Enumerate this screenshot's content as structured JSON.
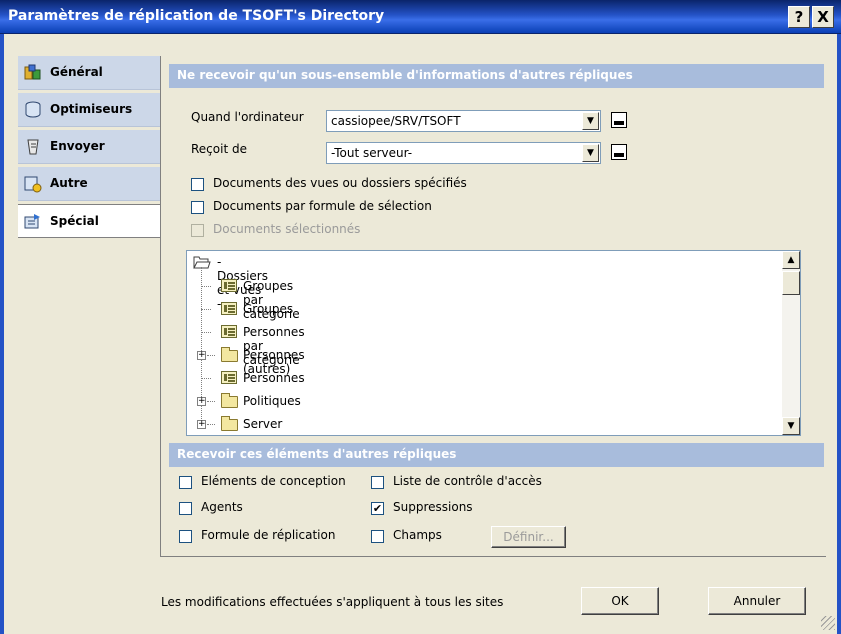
{
  "window": {
    "title": "Paramètres de réplication de TSOFT's Directory",
    "help_glyph": "?",
    "close_glyph": "X"
  },
  "sidebar": {
    "items": [
      {
        "label": "Général",
        "icon": "general-icon"
      },
      {
        "label": "Optimiseurs",
        "icon": "database-icon"
      },
      {
        "label": "Envoyer",
        "icon": "send-icon"
      },
      {
        "label": "Autre",
        "icon": "other-icon"
      },
      {
        "label": "Spécial",
        "icon": "special-icon",
        "active": true
      }
    ]
  },
  "section1": {
    "header": "Ne recevoir qu'un sous-ensemble d'informations d'autres répliques",
    "when_label": "Quand l'ordinateur",
    "when_value": "cassiopee/SRV/TSOFT",
    "from_label": "Reçoit de",
    "from_value": "-Tout serveur-",
    "chk_views": "Documents des vues ou dossiers spécifiés",
    "chk_formula": "Documents par formule de sélection",
    "chk_selected": "Documents sélectionnés"
  },
  "tree": {
    "root": "- Dossiers et vues -",
    "items": [
      {
        "label": "Groupes par catégorie",
        "kind": "view"
      },
      {
        "label": "Groupes",
        "kind": "view"
      },
      {
        "label": "Personnes par catégorie",
        "kind": "view"
      },
      {
        "label": "Personnes (autres)",
        "kind": "folder"
      },
      {
        "label": "Personnes",
        "kind": "view"
      },
      {
        "label": "Politiques",
        "kind": "folder"
      },
      {
        "label": "Server",
        "kind": "folder"
      }
    ],
    "expander_glyph": "+",
    "scroll_up": "▲",
    "scroll_down": "▼"
  },
  "section2": {
    "header": "Recevoir ces éléments d'autres répliques",
    "design": "Eléments de conception",
    "acl": "Liste de contrôle d'accès",
    "agents": "Agents",
    "deletions": "Suppressions",
    "deletions_checked": "✔",
    "formula": "Formule de réplication",
    "fields": "Champs",
    "define": "Définir..."
  },
  "footer": {
    "note": "Les modifications effectuées s'appliquent à tous les sites",
    "ok": "OK",
    "cancel": "Annuler"
  },
  "colors": {
    "title_bar": "#2452c6",
    "section_header": "#a8bcdc",
    "sidebar_bg": "#ccd7e8",
    "window_bg": "#ece9d8"
  }
}
